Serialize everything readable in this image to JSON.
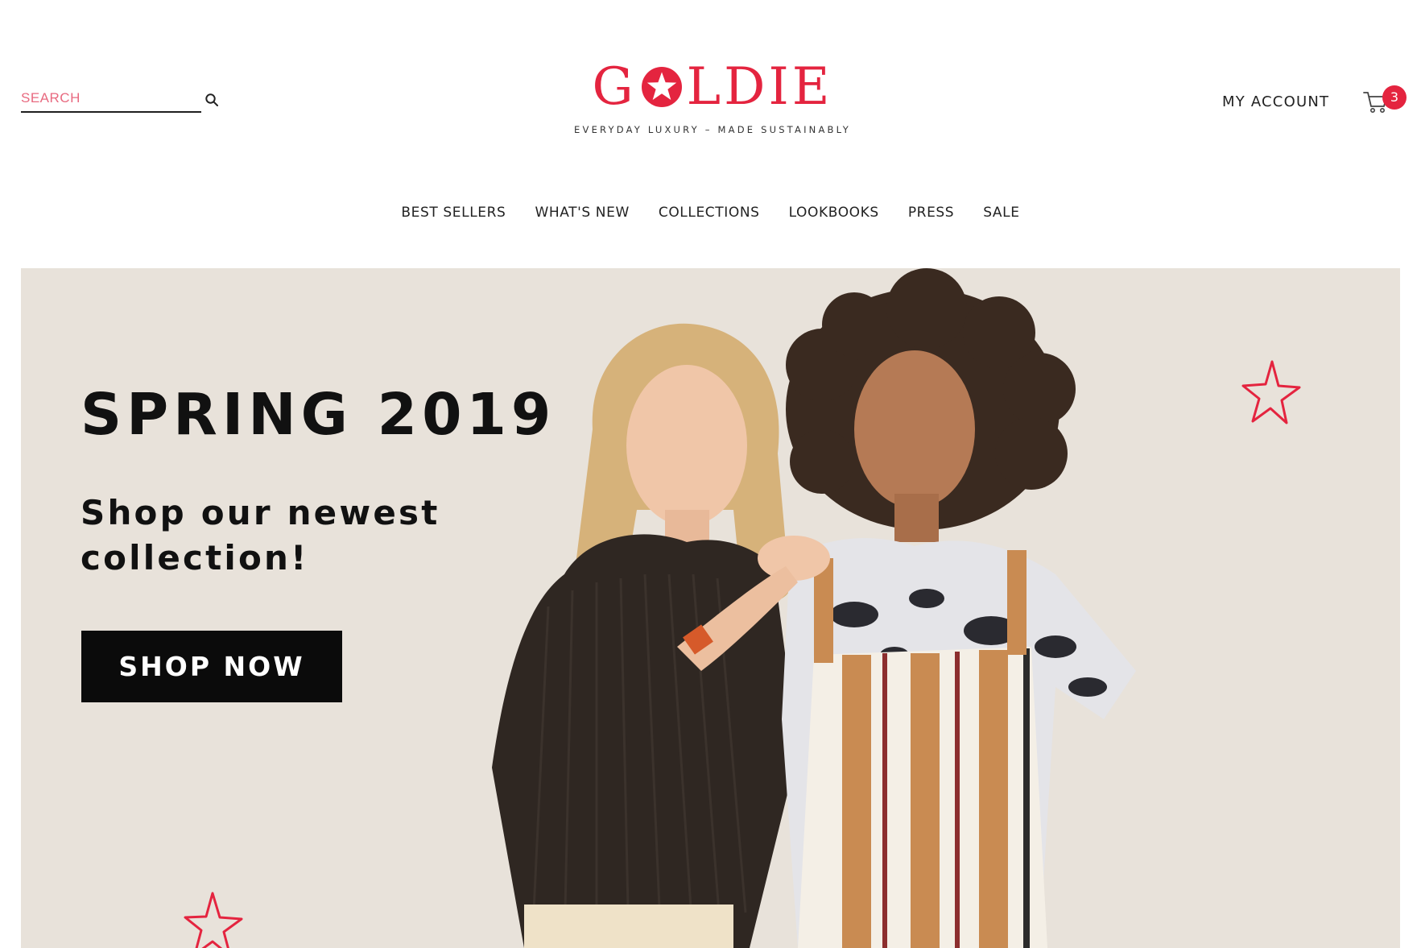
{
  "header": {
    "search": {
      "placeholder": "SEARCH",
      "icon": "search-icon"
    },
    "logo": {
      "letters_before": "G",
      "letters_after": "LDIE",
      "tagline": "EVERYDAY LUXURY – MADE SUSTAINABLY",
      "icon": "star-o-icon"
    },
    "account_label": "MY ACCOUNT",
    "cart": {
      "icon": "cart-icon",
      "count": "3"
    }
  },
  "nav": {
    "items": [
      {
        "label": "BEST SELLERS"
      },
      {
        "label": "WHAT'S NEW"
      },
      {
        "label": "COLLECTIONS"
      },
      {
        "label": "LOOKBOOKS"
      },
      {
        "label": "PRESS"
      },
      {
        "label": "SALE"
      }
    ]
  },
  "hero": {
    "title": "SPRING 2019",
    "subtitle": "Shop our newest collection!",
    "cta_label": "SHOP NOW",
    "image": "two-models-photo",
    "decorations": [
      "star-outline-icon",
      "star-outline-icon"
    ]
  },
  "colors": {
    "brand": "#e4243f",
    "hero_bg": "#e8e2da",
    "cta_bg": "#0b0b0b",
    "text": "#222222"
  }
}
